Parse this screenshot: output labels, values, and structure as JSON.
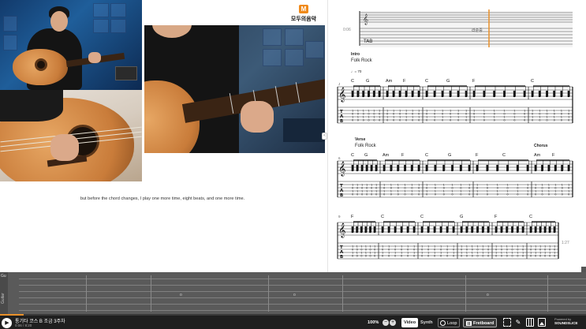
{
  "video": {
    "logo_text": "모두의음악",
    "logo_mark": "M",
    "subtitle": "but before the chord changes, I play one more time, eight beats, and one more time.",
    "side_handle": "<"
  },
  "score": {
    "top_time": "0:06",
    "top_rest_label": "라순중",
    "sections": [
      {
        "label": "Intro",
        "style": "Folk Rock",
        "tempo": "♩= 70"
      },
      {
        "label": "Verse",
        "style": "Folk Rock"
      },
      {
        "label": "Chorus"
      }
    ],
    "system1_chords": [
      "C",
      "G",
      "Am",
      "F",
      "C",
      "G",
      "F",
      "C"
    ],
    "system2_chords": [
      "C",
      "G",
      "Am",
      "F",
      "C",
      "G",
      "F",
      "C",
      "Am",
      "F"
    ],
    "system3_chords": [
      "F",
      "C",
      "C",
      "G",
      "F",
      "C"
    ],
    "system2_number": "6",
    "system3_number": "9",
    "system1_number": "J",
    "time_marker": "1:27"
  },
  "track": {
    "label": "Guitar",
    "top": "Gu"
  },
  "player": {
    "title": "통기타 코스 B  조금 3주차",
    "time": "0:06 / 8:20",
    "progress": 0.04,
    "zoom": "100%",
    "zoom_minus": "−",
    "zoom_plus": "+",
    "video_label": "Video",
    "synth_label": "Synth",
    "loop_label": "Loop",
    "fretboard_label": "Fretboard",
    "edit_icon": "✎",
    "powered_by": "Powered by",
    "brand": "SOUNDSLICE",
    "play_icon": "▶"
  },
  "colors": {
    "accent": "#e8902a",
    "playhead": "#e8902a",
    "toolbar_bg": "#1f1f1f",
    "track_bg": "#5a5a5a"
  }
}
